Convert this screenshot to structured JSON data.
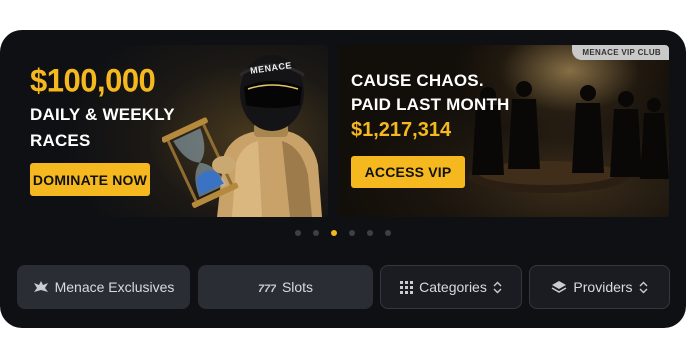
{
  "banners": [
    {
      "amount": "$100,000",
      "line1": "DAILY & WEEKLY",
      "line2": "RACES",
      "cta": "DOMINATE NOW",
      "helmet_text": "MENACE"
    },
    {
      "badge": "MENACE VIP CLUB",
      "line1": "CAUSE CHAOS.",
      "line2": "PAID LAST MONTH",
      "amount": "$1,217,314",
      "cta": "ACCESS VIP"
    }
  ],
  "carousel": {
    "total": 6,
    "active_index": 2
  },
  "tabs": [
    {
      "label": "Menace Exclusives",
      "icon": "menace-logo-icon"
    },
    {
      "label": "Slots",
      "icon": "slots-777-icon"
    },
    {
      "label": "Categories",
      "icon": "grid-icon",
      "dropdown": true
    },
    {
      "label": "Providers",
      "icon": "layers-icon",
      "dropdown": true
    }
  ],
  "colors": {
    "accent": "#f5b81f",
    "background": "#0e1014",
    "tab": "#2a2d34"
  }
}
